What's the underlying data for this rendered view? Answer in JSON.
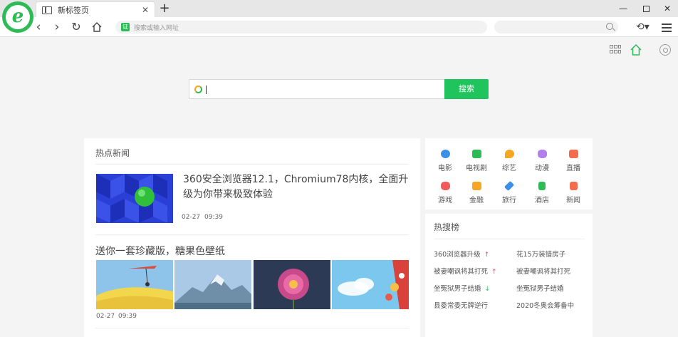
{
  "browser": {
    "tab_title": "新标签页",
    "tab_close": "✕",
    "new_tab": "+",
    "address_badge": "证",
    "address_placeholder": "搜索或输入网址"
  },
  "search": {
    "button_label": "搜索"
  },
  "news": {
    "heading": "热点新闻",
    "items": [
      {
        "title": "360安全浏览器12.1，Chromium78内核，全面升级为你带来极致体验",
        "date": "02-27",
        "time": "09:39"
      },
      {
        "title": "送你一套珍藏版，糖果色壁纸",
        "date": "02-27",
        "time": "09:39"
      }
    ]
  },
  "categories": [
    {
      "label": "电影",
      "icon": "film-icon",
      "color": "#3c8fe6"
    },
    {
      "label": "电视剧",
      "icon": "tv-icon",
      "color": "#2dbb55"
    },
    {
      "label": "综艺",
      "icon": "mic-icon",
      "color": "#f5a623"
    },
    {
      "label": "动漫",
      "icon": "anime-icon",
      "color": "#b37feb"
    },
    {
      "label": "直播",
      "icon": "camera-icon",
      "color": "#f56c4c"
    },
    {
      "label": "游戏",
      "icon": "gamepad-icon",
      "color": "#f05a5a"
    },
    {
      "label": "金融",
      "icon": "finance-icon",
      "color": "#f5a623"
    },
    {
      "label": "旅行",
      "icon": "plane-icon",
      "color": "#3c8fe6"
    },
    {
      "label": "酒店",
      "icon": "hotel-icon",
      "color": "#2dbb55"
    },
    {
      "label": "新闻",
      "icon": "news-icon",
      "color": "#f56c4c"
    }
  ],
  "hot_search": {
    "heading": "热搜榜",
    "items": [
      {
        "label": "360浏览器升级",
        "trend": "up"
      },
      {
        "label": "花15万装错房子",
        "trend": "none"
      },
      {
        "label": "被妻嘲讽将其打死",
        "trend": "up"
      },
      {
        "label": "被妻嘲讽将其打死",
        "trend": "none"
      },
      {
        "label": "坐冤狱男子结婚",
        "trend": "down"
      },
      {
        "label": "坐冤狱男子结婚",
        "trend": "none"
      },
      {
        "label": "县委常委无牌逆行",
        "trend": "none"
      },
      {
        "label": "2020冬奥会筹备中",
        "trend": "none"
      }
    ],
    "arrow_up": "↑",
    "arrow_down": "↓"
  }
}
